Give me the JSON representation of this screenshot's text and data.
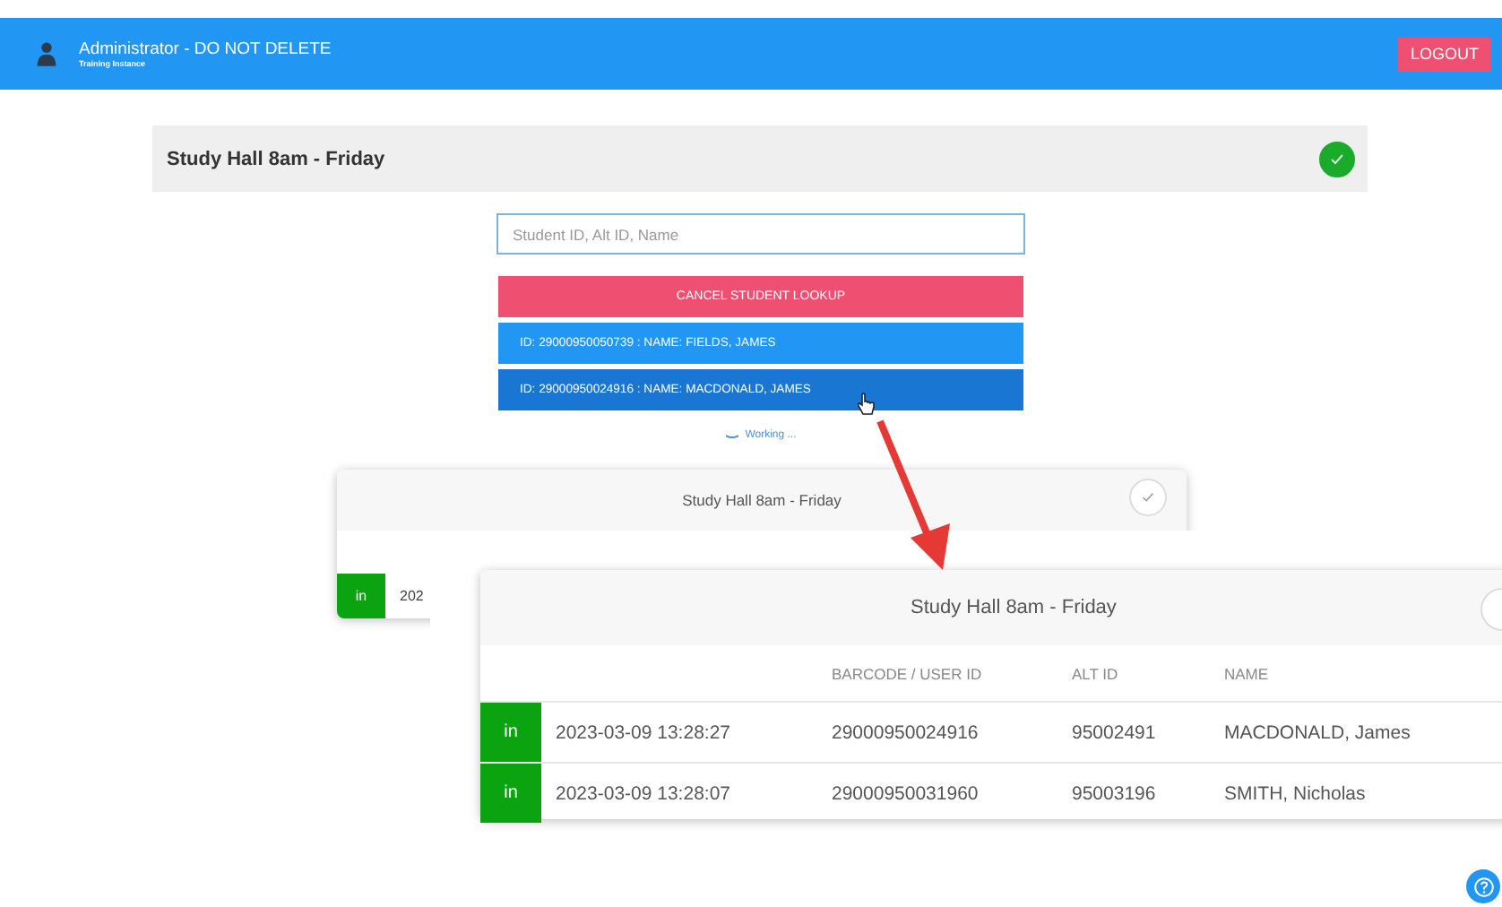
{
  "top_bar": {
    "title": "Administrator - DO NOT DELETE",
    "subtitle": "Training Instance",
    "logout": "LOGOUT"
  },
  "session_card": {
    "title": "Study Hall 8am - Friday",
    "completed": true
  },
  "lookup": {
    "placeholder": "Student ID, Alt ID, Name",
    "cancel_label": "CANCEL STUDENT LOOKUP",
    "results": [
      {
        "label": "ID: 29000950050739 : NAME: FIELDS, JAMES",
        "selected": false
      },
      {
        "label": "ID: 29000950024916 : NAME: MACDONALD, JAMES",
        "selected": true
      }
    ],
    "status": "Working ..."
  },
  "back_card": {
    "title": "Study Hall 8am - Friday",
    "completed": false,
    "rows": [
      {
        "status": "in",
        "time": "202"
      }
    ]
  },
  "front_card": {
    "title": "Study Hall 8am - Friday",
    "columns": [
      "BARCODE / USER ID",
      "ALT ID",
      "NAME"
    ],
    "rows": [
      {
        "status": "in",
        "time": "2023-03-09 13:28:27",
        "barcode": "29000950024916",
        "alt_id": "95002491",
        "name": "MACDONALD, James"
      },
      {
        "status": "in",
        "time": "2023-03-09 13:28:07",
        "barcode": "29000950031960",
        "alt_id": "95003196",
        "name": "SMITH, Nicholas"
      }
    ]
  }
}
